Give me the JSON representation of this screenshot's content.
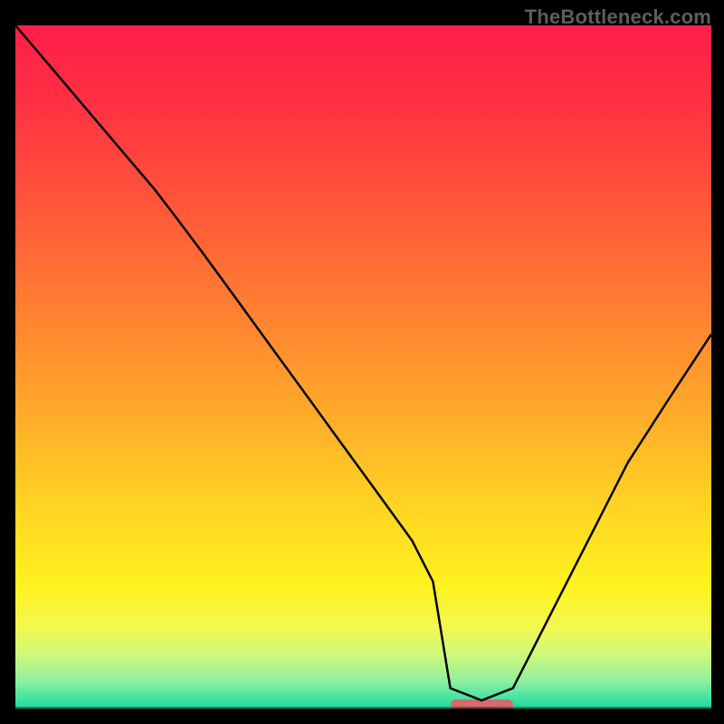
{
  "watermark": "TheBottleneck.com",
  "colors": {
    "bg": "#000000",
    "curve": "#000000",
    "grad_stops": [
      {
        "offset": 0.0,
        "color": "#ff1f49"
      },
      {
        "offset": 0.1,
        "color": "#ff2e43"
      },
      {
        "offset": 0.25,
        "color": "#ff533b"
      },
      {
        "offset": 0.4,
        "color": "#ff7b33"
      },
      {
        "offset": 0.55,
        "color": "#ffa52b"
      },
      {
        "offset": 0.7,
        "color": "#ffd323"
      },
      {
        "offset": 0.82,
        "color": "#fff21f"
      },
      {
        "offset": 0.88,
        "color": "#f2f84e"
      },
      {
        "offset": 0.92,
        "color": "#d0f87a"
      },
      {
        "offset": 0.96,
        "color": "#8ff0a0"
      },
      {
        "offset": 0.985,
        "color": "#43e2a2"
      },
      {
        "offset": 1.0,
        "color": "#1fd89a"
      }
    ],
    "marker": "#d46a6a"
  },
  "marker": {
    "x0_frac": 0.625,
    "x1_frac": 0.715,
    "y_frac": 0.993
  },
  "chart_data": {
    "type": "line",
    "title": "",
    "xlabel": "",
    "ylabel": "",
    "xlim": [
      0,
      1
    ],
    "ylim": [
      0,
      1
    ],
    "x": [
      0.0,
      0.05,
      0.1,
      0.15,
      0.2,
      0.23,
      0.27,
      0.32,
      0.37,
      0.42,
      0.47,
      0.52,
      0.57,
      0.6,
      0.625,
      0.67,
      0.715,
      0.74,
      0.78,
      0.83,
      0.88,
      0.94,
      1.0
    ],
    "values": [
      1.0,
      0.94,
      0.88,
      0.82,
      0.76,
      0.72,
      0.666,
      0.596,
      0.526,
      0.456,
      0.386,
      0.316,
      0.246,
      0.186,
      0.03,
      0.012,
      0.03,
      0.08,
      0.16,
      0.26,
      0.36,
      0.455,
      0.548
    ],
    "optimum_band": {
      "x0": 0.625,
      "x1": 0.715
    },
    "notes": "V-shaped bottleneck curve over a vertical red→green gradient. Minimum (optimal) region highlighted near x≈0.63–0.72. No axis ticks or numeric labels are visible in the image; values are fractional estimates in [0,1]."
  }
}
